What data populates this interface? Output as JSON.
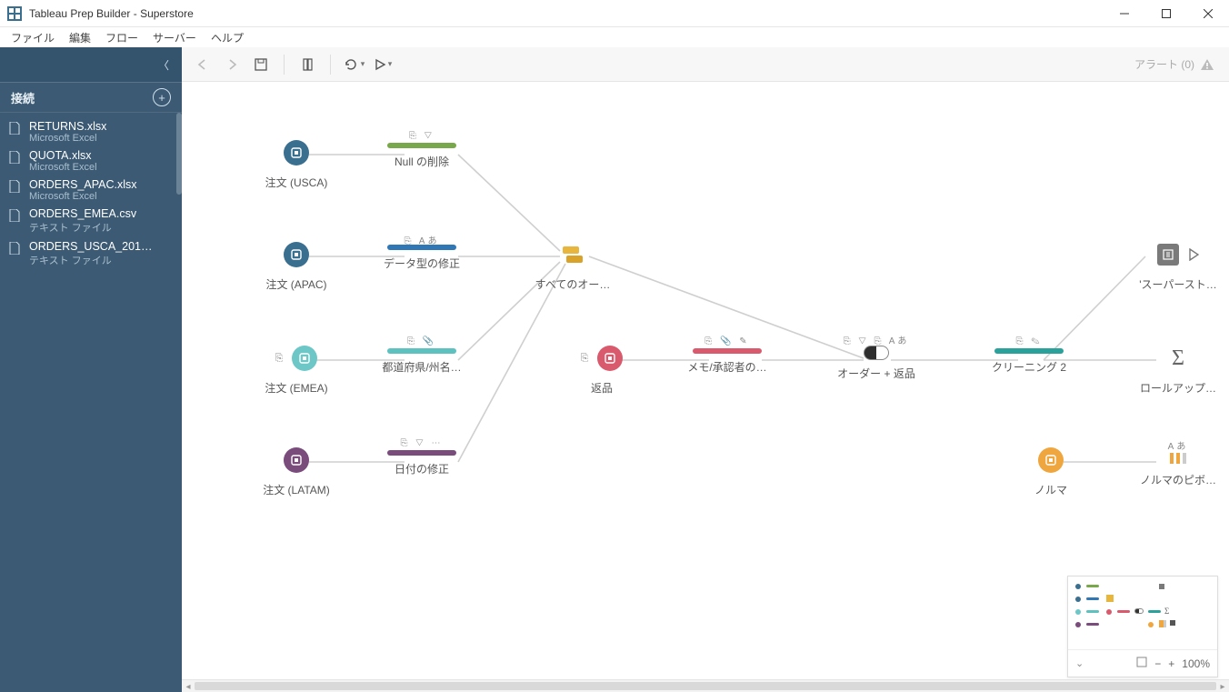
{
  "window": {
    "title": "Tableau Prep Builder - Superstore"
  },
  "menu": {
    "items": [
      "ファイル",
      "編集",
      "フロー",
      "サーバー",
      "ヘルプ"
    ]
  },
  "sidebar": {
    "header": "接続",
    "connections": [
      {
        "name": "RETURNS.xlsx",
        "type": "Microsoft Excel"
      },
      {
        "name": "QUOTA.xlsx",
        "type": "Microsoft Excel"
      },
      {
        "name": "ORDERS_APAC.xlsx",
        "type": "Microsoft Excel"
      },
      {
        "name": "ORDERS_EMEA.csv",
        "type": "テキスト ファイル"
      },
      {
        "name": "ORDERS_USCA_201…",
        "type": "テキスト ファイル"
      }
    ]
  },
  "toolbar": {
    "alerts_label": "アラート (0)"
  },
  "flow": {
    "nodes": {
      "orders_usca": {
        "label": "注文 (USCA)",
        "color": "#3b6f8f"
      },
      "orders_apac": {
        "label": "注文 (APAC)",
        "color": "#3b6f8f"
      },
      "orders_emea": {
        "label": "注文 (EMEA)",
        "color": "#6dc7c7"
      },
      "orders_latam": {
        "label": "注文 (LATAM)",
        "color": "#7a4c7c"
      },
      "clean_null": {
        "label": "Null の削除",
        "bar": "#79a84a",
        "icons": "⎘ ▽"
      },
      "fix_types": {
        "label": "データ型の修正",
        "bar": "#2f78b5",
        "icons": "⎘ Aあ"
      },
      "pref_state": {
        "label": "都道府県/州名…",
        "bar": "#5cc1bf",
        "icons": "⎘ 📎"
      },
      "fix_date": {
        "label": "日付の修正",
        "bar": "#7a4c7c",
        "icons": "⎘ ▽ ⋯"
      },
      "union_all": {
        "label": "すべてのオー…"
      },
      "returns": {
        "label": "返品",
        "color": "#d95a6c",
        "icons": "⎘"
      },
      "memo_approver": {
        "label": "メモ/承認者の…",
        "bar": "#d95a6c",
        "icons": "⎘ 📎 ✎"
      },
      "join_orders_returns": {
        "label": "オーダー + 返品",
        "icons": "⎘ ▽ ⎘ Aあ"
      },
      "cleaning2": {
        "label": "クリーニング 2",
        "bar": "#2aa19a",
        "icons": "⎘ ✎"
      },
      "output_superstore": {
        "label": "'スーパースト…"
      },
      "rollup": {
        "label": "ロールアップ…"
      },
      "quota": {
        "label": "ノルマ",
        "color": "#f0a63f"
      },
      "quota_pivot": {
        "label": "ノルマのピボ…",
        "icons": "Aあ"
      }
    }
  },
  "minimap": {
    "zoom": "100%"
  }
}
